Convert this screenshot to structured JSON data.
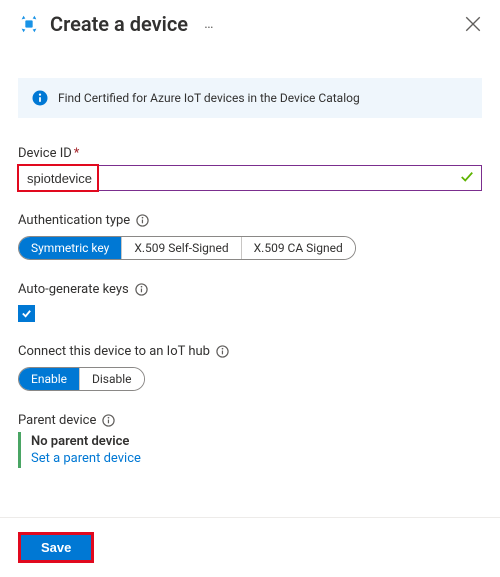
{
  "header": {
    "title": "Create a device",
    "more_glyph": "…"
  },
  "banner": {
    "text": "Find Certified for Azure IoT devices in the Device Catalog"
  },
  "device_id": {
    "label": "Device ID",
    "required_glyph": "*",
    "value": "spiotdevice"
  },
  "auth_type": {
    "label": "Authentication type",
    "options": [
      {
        "label": "Symmetric key",
        "active": true
      },
      {
        "label": "X.509 Self-Signed",
        "active": false
      },
      {
        "label": "X.509 CA Signed",
        "active": false
      }
    ]
  },
  "auto_gen": {
    "label": "Auto-generate keys",
    "checked": true
  },
  "connect_hub": {
    "label": "Connect this device to an IoT hub",
    "options": [
      {
        "label": "Enable",
        "active": true
      },
      {
        "label": "Disable",
        "active": false
      }
    ]
  },
  "parent": {
    "label": "Parent device",
    "status": "No parent device",
    "link": "Set a parent device"
  },
  "footer": {
    "save_label": "Save"
  }
}
